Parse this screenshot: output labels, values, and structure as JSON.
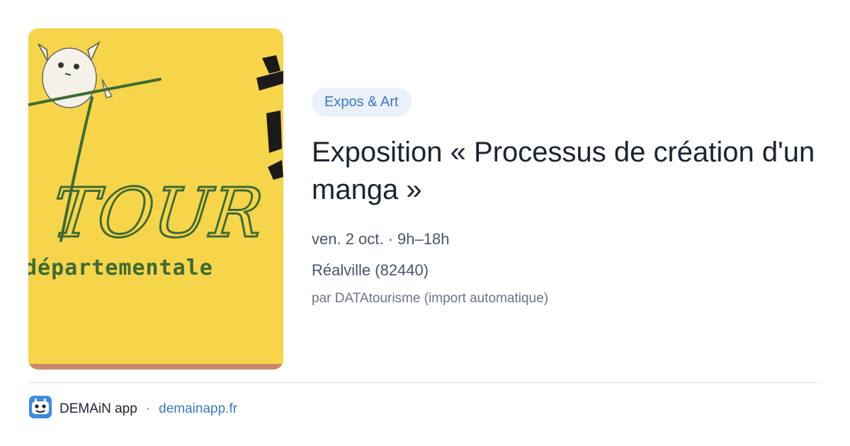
{
  "image": {
    "alt": "Tour départementale poster",
    "lettering_word": "TOUR",
    "lettering_subtitle": "départementale",
    "background_color": "#f6d54a",
    "ink_color": "#3d6a35"
  },
  "event": {
    "category": "Expos & Art",
    "title": "Exposition « Processus de création d'un manga »",
    "datetime": "ven. 2 oct. · 9h–18h",
    "location": "Réalville (82440)",
    "source": "par DATAtourisme (import automatique)"
  },
  "footer": {
    "app_name": "DEMAiN app",
    "separator": "·",
    "domain": "demainapp.fr",
    "logo_icon": "robot-face-icon"
  },
  "colors": {
    "accent": "#3b78c6",
    "badge_bg": "#eaf1fb",
    "title": "#1a2433"
  }
}
